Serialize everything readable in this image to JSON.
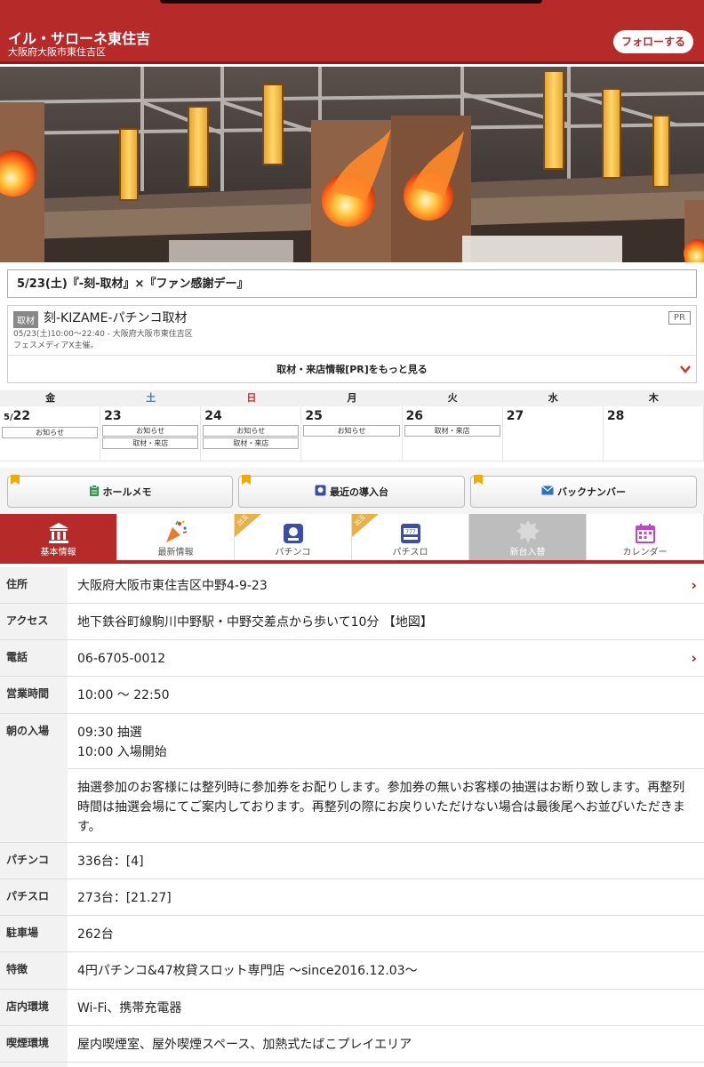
{
  "header": {
    "title": "イル・サローネ東住吉",
    "subtitle": "大阪府大阪市東住吉区",
    "follow_label": "フォローする"
  },
  "event": {
    "title": "5/23(土)『-刻-取材』×『ファン感謝デー』"
  },
  "pr": {
    "tag": "取材",
    "title": "刻-KIZAME-パチンコ取材",
    "badge": "PR",
    "line1": "05/23(土)10:00〜22:40 - 大阪府大阪市東住吉区",
    "line2": "フェスメディアX主催。",
    "more_label": "取材・来店情報[PR]をもっと見る"
  },
  "calendar": {
    "weekdays": [
      "金",
      "土",
      "日",
      "月",
      "火",
      "水",
      "木"
    ],
    "days": [
      {
        "month": "5/",
        "date": "22",
        "tags": [
          "お知らせ"
        ]
      },
      {
        "month": "",
        "date": "23",
        "tags": [
          "お知らせ",
          "取材・来店"
        ]
      },
      {
        "month": "",
        "date": "24",
        "tags": [
          "お知らせ",
          "取材・来店"
        ]
      },
      {
        "month": "",
        "date": "25",
        "tags": [
          "お知らせ"
        ]
      },
      {
        "month": "",
        "date": "26",
        "tags": [
          "取材・来店"
        ]
      },
      {
        "month": "",
        "date": "27",
        "tags": []
      },
      {
        "month": "",
        "date": "28",
        "tags": []
      }
    ]
  },
  "quick": {
    "memo": "ホールメモ",
    "recent": "最近の導入台",
    "backnumber": "バックナンバー"
  },
  "tabs": {
    "basic": "基本情報",
    "news": "最新情報",
    "pachinko": "パチンコ",
    "pachislo": "パチスロ",
    "newmachine": "新台入替",
    "calendar": "カレンダー",
    "ribbon": "出玉",
    "new_badge": "NEW"
  },
  "info": {
    "address_k": "住所",
    "address_v": "大阪府大阪市東住吉区中野4-9-23",
    "access_k": "アクセス",
    "access_v": "地下鉄谷町線駒川中野駅・中野交差点から歩いて10分 【地図】",
    "phone_k": "電話",
    "phone_v": "06-6705-0012",
    "hours_k": "営業時間",
    "hours_v": "10:00 〜 22:50",
    "entry_k": "朝の入場",
    "entry_v1": "09:30 抽選",
    "entry_v2": "10:00 入場開始",
    "entry_note": "抽選参加のお客様には整列時に参加券をお配りします。参加券の無いお客様の抽選はお断り致します。再整列時間は抽選会場にてご案内しております。再整列の際にお戻りいただけない場合は最後尾へお並びいただきます。",
    "pachinko_k": "パチンコ",
    "pachinko_v": "336台：[4]",
    "pachislo_k": "パチスロ",
    "pachislo_v": "273台：[21.27]",
    "parking_k": "駐車場",
    "parking_v": "262台",
    "feature_k": "特徴",
    "feature_v": "4円パチンコ&47枚貸スロット専門店 〜since2016.12.03〜",
    "env_k": "店内環境",
    "env_v": "Wi-Fi、携帯充電器",
    "smoke_k": "喫煙環境",
    "smoke_v": "屋内喫煙室、屋外喫煙スペース、加熱式たばこプレイエリア"
  },
  "colors": {
    "brand": "#b62a2a",
    "saturday": "#2a7fc9",
    "sunday": "#d02828"
  }
}
